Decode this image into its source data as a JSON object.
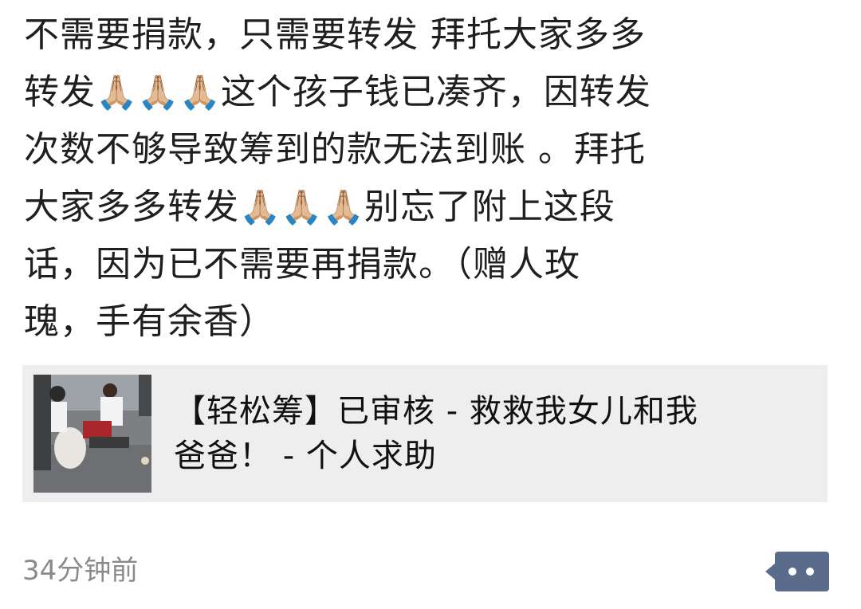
{
  "post": {
    "line1": "不需要捐款，只需要转发 拜托大家多多",
    "line2_a": "转发",
    "line2_emoji": "🙏🏼🙏🏼🙏🏼",
    "line2_b": "这个孩子钱已凑齐，因转发",
    "line3": "次数不够导致筹到的款无法到账 。拜托",
    "line4_a": "大家多多转发",
    "line4_emoji": "🙏🏼🙏🏼🙏🏼",
    "line4_b": "别忘了附上这段",
    "line5": "话，因为已不需要再捐款。（赠人玫",
    "line6": "瑰，手有余香）"
  },
  "link_card": {
    "title_line1": "【轻松筹】已审核 - 救救我女儿和我",
    "title_line2": "爸爸！ - 个人求助"
  },
  "timestamp": "34分钟前",
  "colors": {
    "card_background": "#eeeeee",
    "timestamp": "#8a8a8a",
    "comment_button": "#5b6b8c"
  },
  "icons": {
    "comment": "comment-more-icon",
    "emoji": "folded-hands"
  }
}
